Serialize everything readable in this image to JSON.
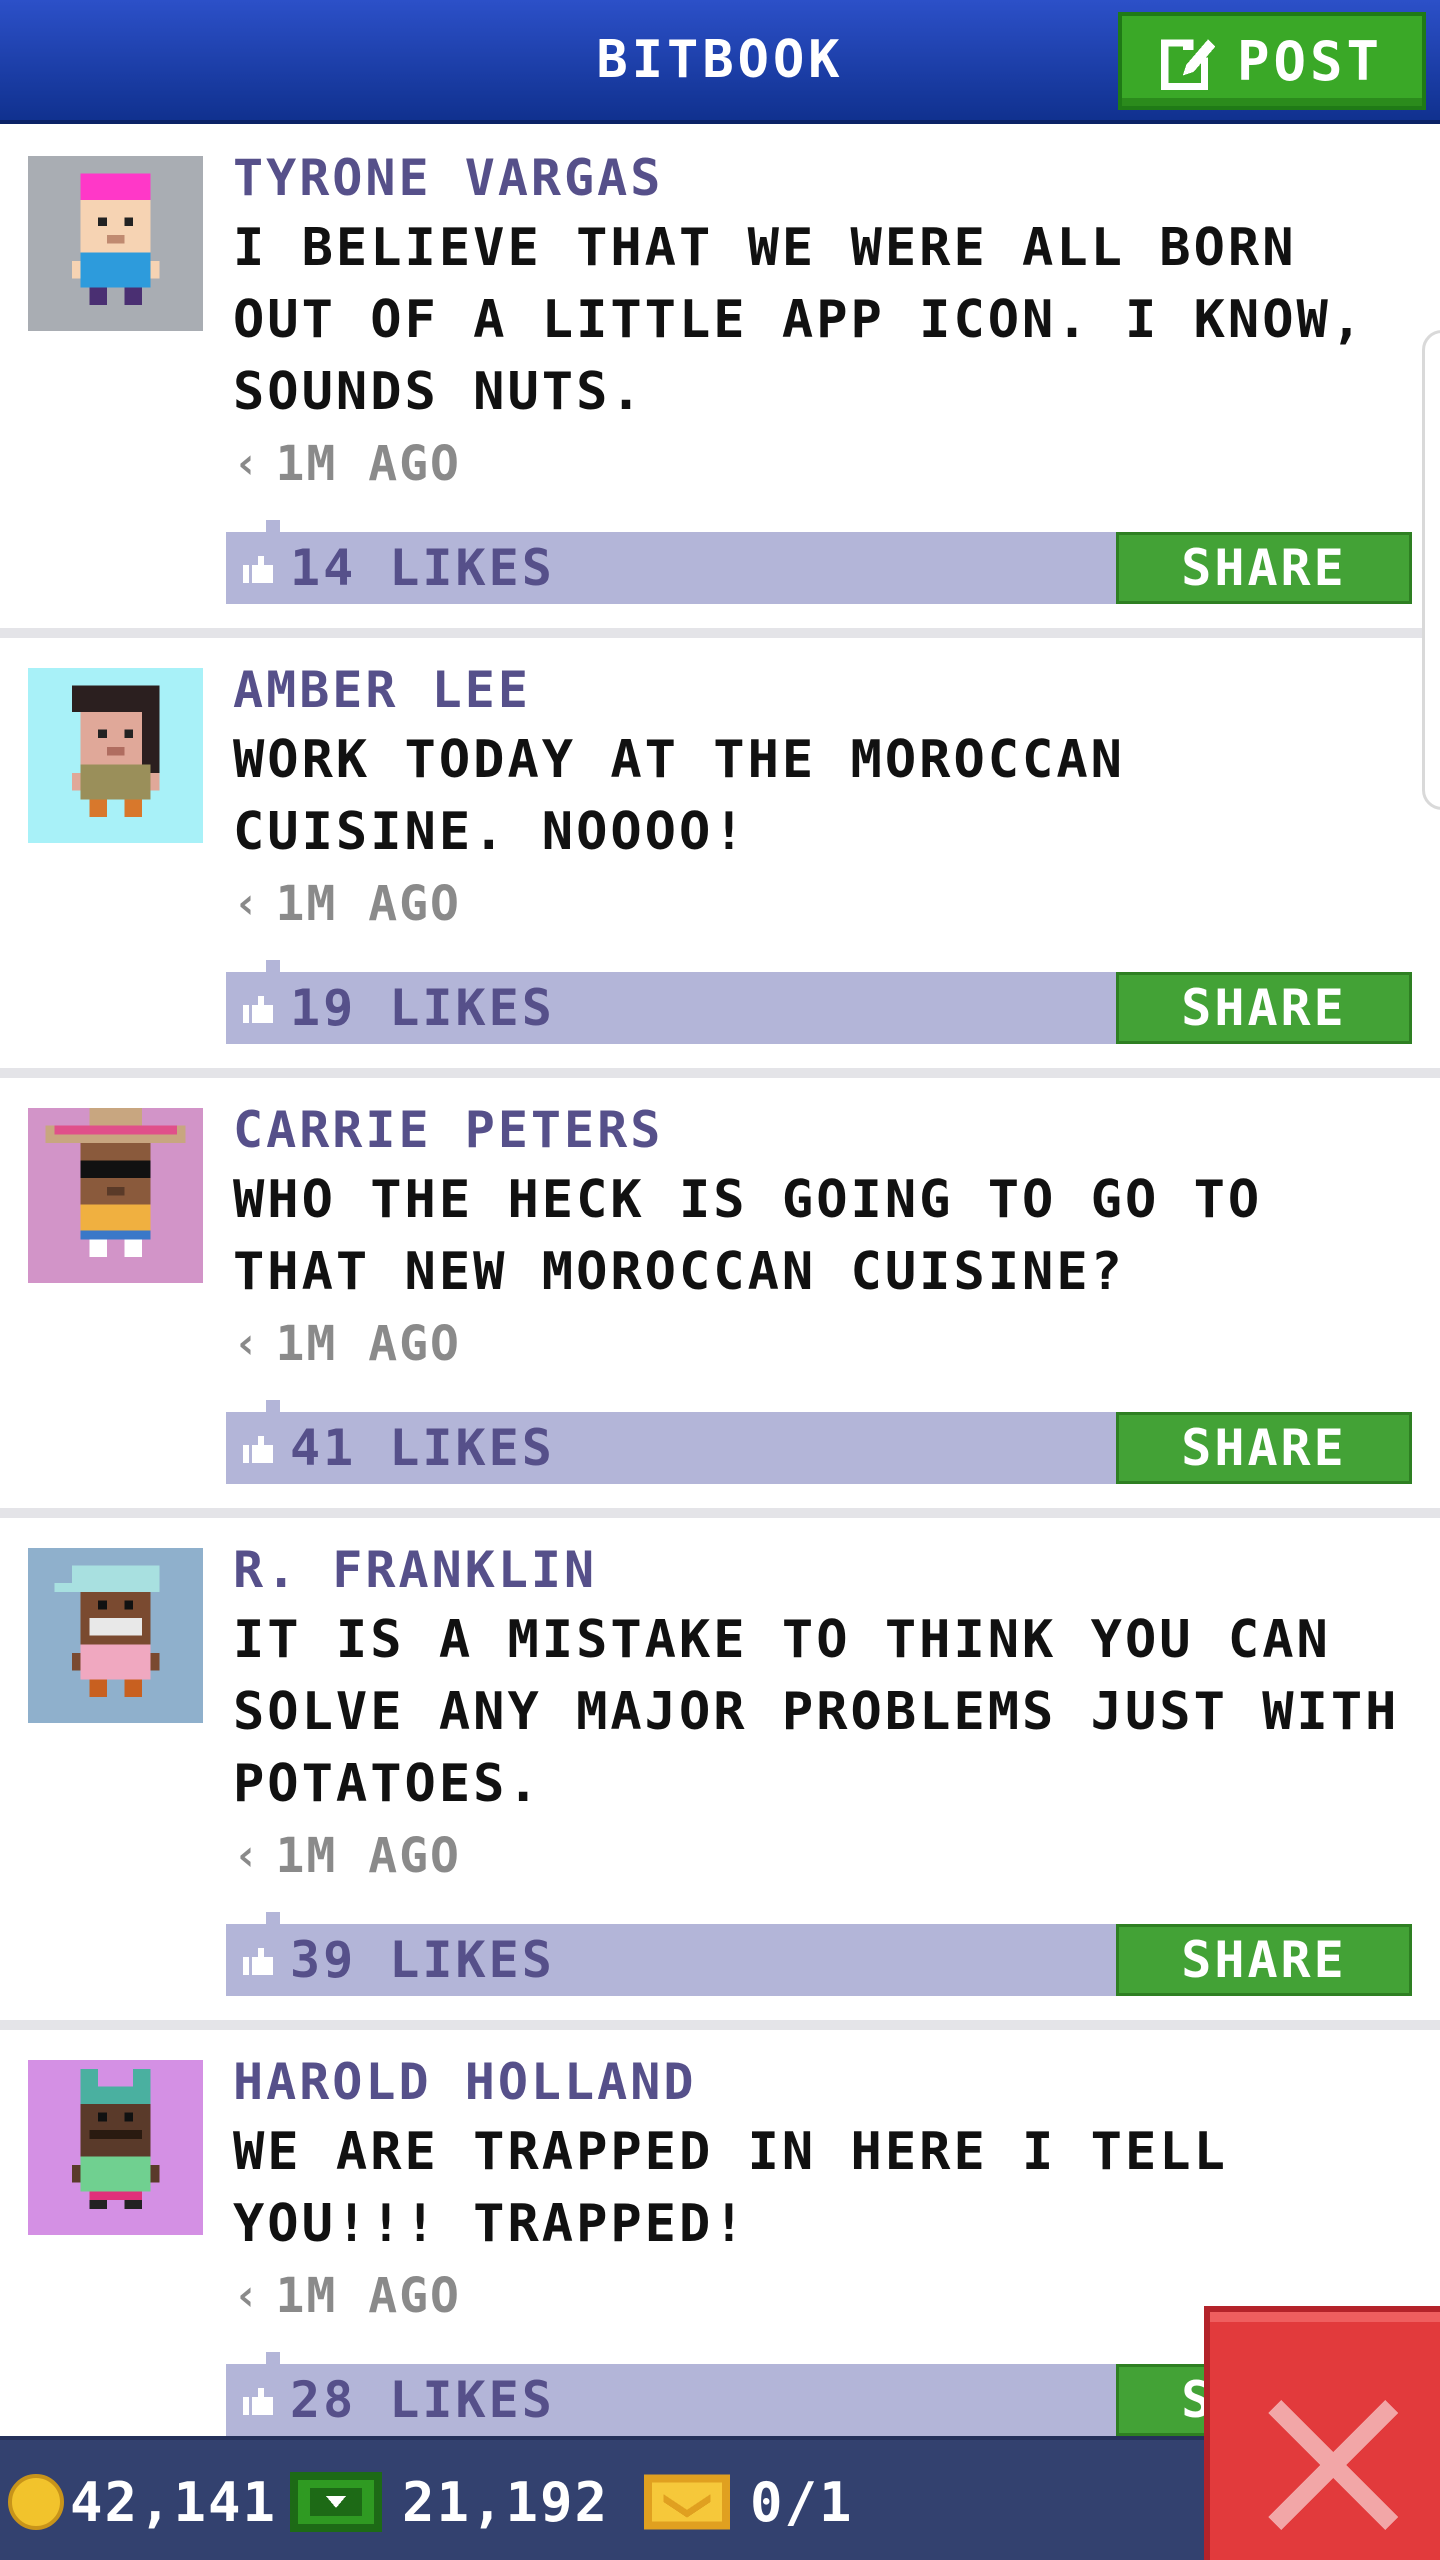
{
  "header": {
    "title": "BITBOOK",
    "post_label": "POST"
  },
  "posts": [
    {
      "author": "TYRONE VARGAS",
      "message": "I BELIEVE THAT WE WERE ALL BORN OUT OF A LITTLE APP ICON. I KNOW, SOUNDS NUTS.",
      "time": "1M AGO",
      "likes": "14 LIKES",
      "share": "SHARE",
      "avatar_bg": "#a9adb3"
    },
    {
      "author": "AMBER LEE",
      "message": "WORK TODAY AT THE MOROCCAN CUISINE. NOOOO!",
      "time": "1M AGO",
      "likes": "19 LIKES",
      "share": "SHARE",
      "avatar_bg": "#a8f1f8"
    },
    {
      "author": "CARRIE PETERS",
      "message": "WHO THE HECK IS GOING TO GO TO THAT NEW MOROCCAN CUISINE?",
      "time": "1M AGO",
      "likes": "41 LIKES",
      "share": "SHARE",
      "avatar_bg": "#d294c8"
    },
    {
      "author": "R. FRANKLIN",
      "message": "IT IS A MISTAKE TO THINK YOU CAN SOLVE ANY MAJOR PROBLEMS JUST WITH POTATOES.",
      "time": "1M AGO",
      "likes": "39 LIKES",
      "share": "SHARE",
      "avatar_bg": "#8fb0cc"
    },
    {
      "author": "HAROLD HOLLAND",
      "message": "WE ARE TRAPPED IN HERE I TELL YOU!!! TRAPPED!",
      "time": "1M AGO",
      "likes": "28 LIKES",
      "share": "SHARE",
      "avatar_bg": "#d490e4"
    }
  ],
  "status": {
    "coins": "42,141",
    "bux": "21,192",
    "tickets": "0/1"
  },
  "colors": {
    "header": "#1f40b0",
    "accent_green": "#43a236",
    "like_bar": "#b3b5d8",
    "author_text": "#56508a",
    "status_bar": "#33416f",
    "close_red": "#e23a3c"
  },
  "icons": {
    "post": "compose-icon",
    "time": "clock-icon",
    "like": "thumbs-up-icon",
    "coin": "coin-icon",
    "bux": "cash-icon",
    "tickets": "ticket-icon",
    "close": "close-icon"
  }
}
